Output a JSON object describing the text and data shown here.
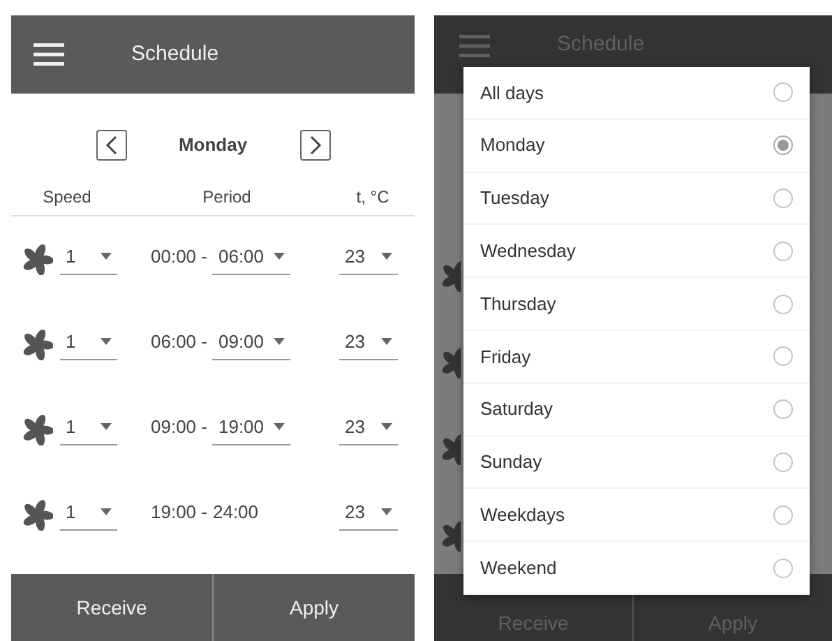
{
  "schedule": {
    "title": "Schedule",
    "day": "Monday",
    "columns": [
      "Speed",
      "Period",
      "t, °C"
    ],
    "rows": [
      {
        "speed": "1",
        "start": "00:00 -",
        "end": "06:00",
        "end_editable": true,
        "temp": "23"
      },
      {
        "speed": "1",
        "start": "06:00 -",
        "end": "09:00",
        "end_editable": true,
        "temp": "23"
      },
      {
        "speed": "1",
        "start": "09:00 -",
        "end": "19:00",
        "end_editable": true,
        "temp": "23"
      },
      {
        "speed": "1",
        "start": "19:00 -",
        "end": "24:00",
        "end_editable": false,
        "temp": "23"
      }
    ],
    "buttons": [
      "Receive",
      "Apply"
    ]
  },
  "day_picker": {
    "background": {
      "title": "Schedule",
      "buttons": [
        "Receive",
        "Apply"
      ]
    },
    "options": [
      {
        "label": "All days",
        "selected": false
      },
      {
        "label": "Monday",
        "selected": true
      },
      {
        "label": "Tuesday",
        "selected": false
      },
      {
        "label": "Wednesday",
        "selected": false
      },
      {
        "label": "Thursday",
        "selected": false
      },
      {
        "label": "Friday",
        "selected": false
      },
      {
        "label": "Saturday",
        "selected": false
      },
      {
        "label": "Sunday",
        "selected": false
      },
      {
        "label": "Weekdays",
        "selected": false
      },
      {
        "label": "Weekend",
        "selected": false
      }
    ]
  }
}
